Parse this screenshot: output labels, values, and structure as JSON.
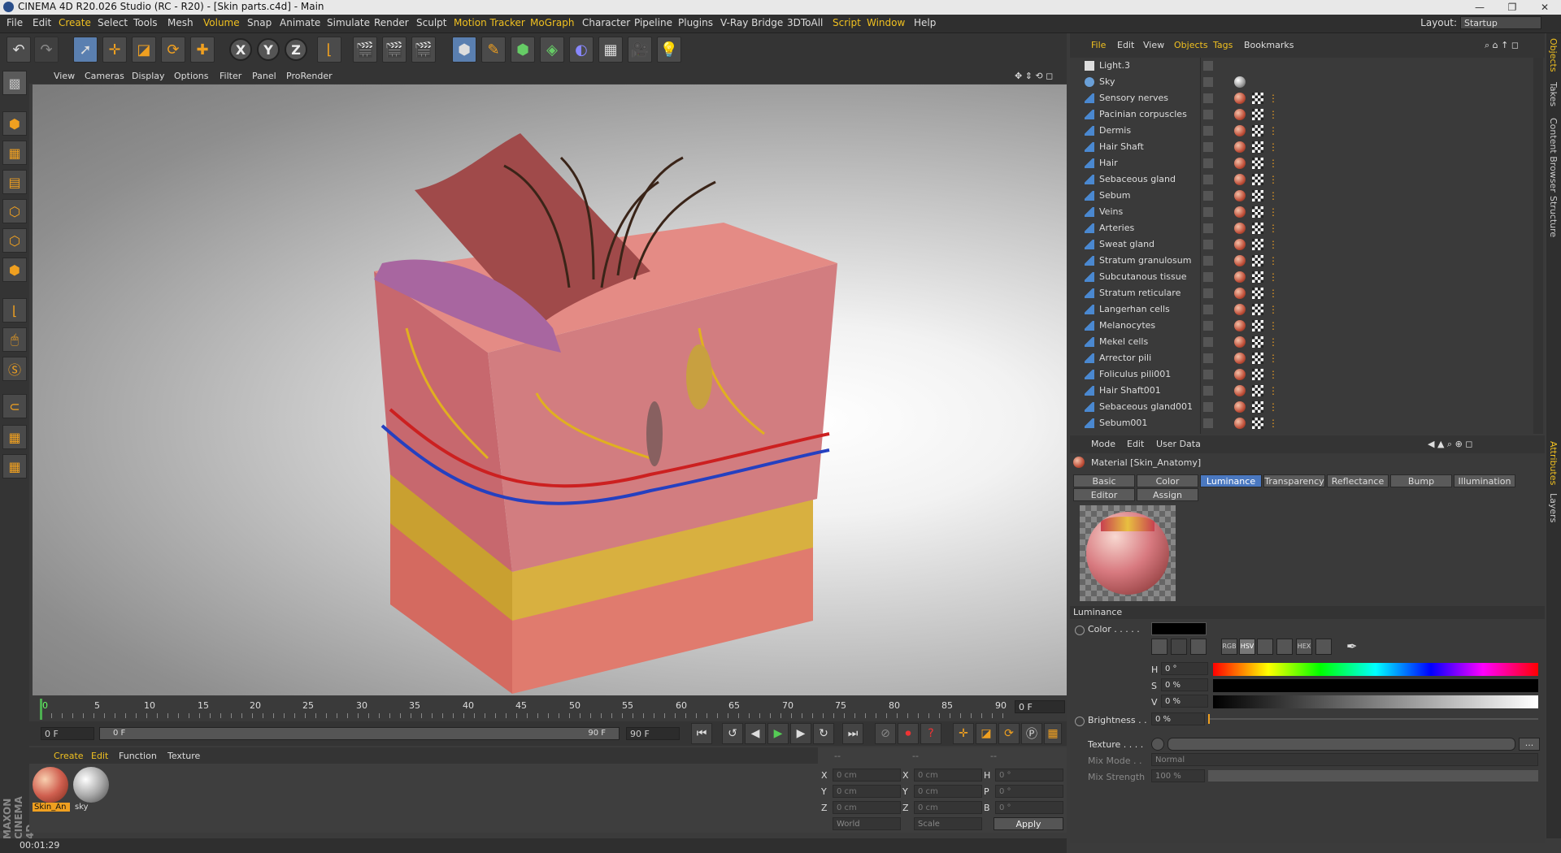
{
  "window": {
    "title": "CINEMA 4D R20.026 Studio (RC - R20) - [Skin parts.c4d] - Main"
  },
  "menubar": {
    "items": [
      "File",
      "Edit",
      "Create",
      "Select",
      "Tools",
      "Mesh",
      "Volume",
      "Snap",
      "Animate",
      "Simulate",
      "Render",
      "Sculpt",
      "Motion Tracker",
      "MoGraph",
      "Character",
      "Pipeline",
      "Plugins",
      "V-Ray Bridge",
      "3DToAll",
      "Script",
      "Window",
      "Help"
    ],
    "layout_label": "Layout:",
    "layout_value": "Startup"
  },
  "viewport": {
    "menu": [
      "View",
      "Cameras",
      "Display",
      "Options",
      "Filter",
      "Panel",
      "ProRender"
    ]
  },
  "timeline": {
    "ticks": [
      "0",
      "5",
      "10",
      "15",
      "20",
      "25",
      "30",
      "35",
      "40",
      "45",
      "50",
      "55",
      "60",
      "65",
      "70",
      "75",
      "80",
      "85",
      "90"
    ],
    "current_frame": "0 F",
    "start": "0 F",
    "range_start": "0 F",
    "range_end": "90 F",
    "end": "90 F"
  },
  "material_manager": {
    "menu": [
      "Create",
      "Edit",
      "Function",
      "Texture"
    ],
    "materials": [
      {
        "name": "Skin_An"
      },
      {
        "name": "sky"
      }
    ]
  },
  "coordinates": {
    "headers": [
      "--",
      "--",
      "--"
    ],
    "rows": [
      {
        "a": "X",
        "av": "0 cm",
        "b": "X",
        "bv": "0 cm",
        "c": "H",
        "cv": "0 °"
      },
      {
        "a": "Y",
        "av": "0 cm",
        "b": "Y",
        "bv": "0 cm",
        "c": "P",
        "cv": "0 °"
      },
      {
        "a": "Z",
        "av": "0 cm",
        "b": "Z",
        "bv": "0 cm",
        "c": "B",
        "cv": "0 °"
      }
    ],
    "mode": "World",
    "scale": "Scale",
    "apply": "Apply"
  },
  "status": {
    "time": "00:01:29"
  },
  "object_manager": {
    "menu": [
      "File",
      "Edit",
      "View",
      "Objects",
      "Tags",
      "Bookmarks"
    ],
    "objects": [
      "Light.3",
      "Sky",
      "Sensory nerves",
      "Pacinian corpuscles",
      "Dermis",
      "Hair Shaft",
      "Hair",
      "Sebaceous gland",
      "Sebum",
      "Veins",
      "Arteries",
      "Sweat gland",
      "Stratum granulosum",
      "Subcutanous tissue",
      "Stratum reticulare",
      "Langerhan cells",
      "Melanocytes",
      "Mekel cells",
      "Arrector pili",
      "Foliculus pili001",
      "Hair Shaft001",
      "Sebaceous gland001",
      "Sebum001"
    ]
  },
  "attributes": {
    "menu": [
      "Mode",
      "Edit",
      "User Data"
    ],
    "material_title": "Material [Skin_Anatomy]",
    "tabs_row1": [
      "Basic",
      "Color",
      "Luminance",
      "Transparency",
      "Reflectance",
      "Bump",
      "Illumination"
    ],
    "tabs_row2": [
      "Editor",
      "Assign"
    ],
    "selected_tab": "Luminance",
    "section": "Luminance",
    "color_label": "Color . . . . .",
    "h_label": "H",
    "h_value": "0 °",
    "s_label": "S",
    "s_value": "0 %",
    "v_label": "V",
    "v_value": "0 %",
    "brightness_label": "Brightness . .",
    "brightness_value": "0 %",
    "texture_label": "Texture . . . .",
    "mixmode_label": "Mix Mode . .",
    "mixmode_value": "Normal",
    "mixstrength_label": "Mix Strength",
    "mixstrength_value": "100 %"
  },
  "side_tabs": [
    "Objects",
    "Takes",
    "Content Browser",
    "Structure",
    "Attributes",
    "Layers"
  ],
  "colors": {
    "accent": "#f0a020",
    "selected_tab": "#4a78c0",
    "brand_text": "#888888"
  }
}
